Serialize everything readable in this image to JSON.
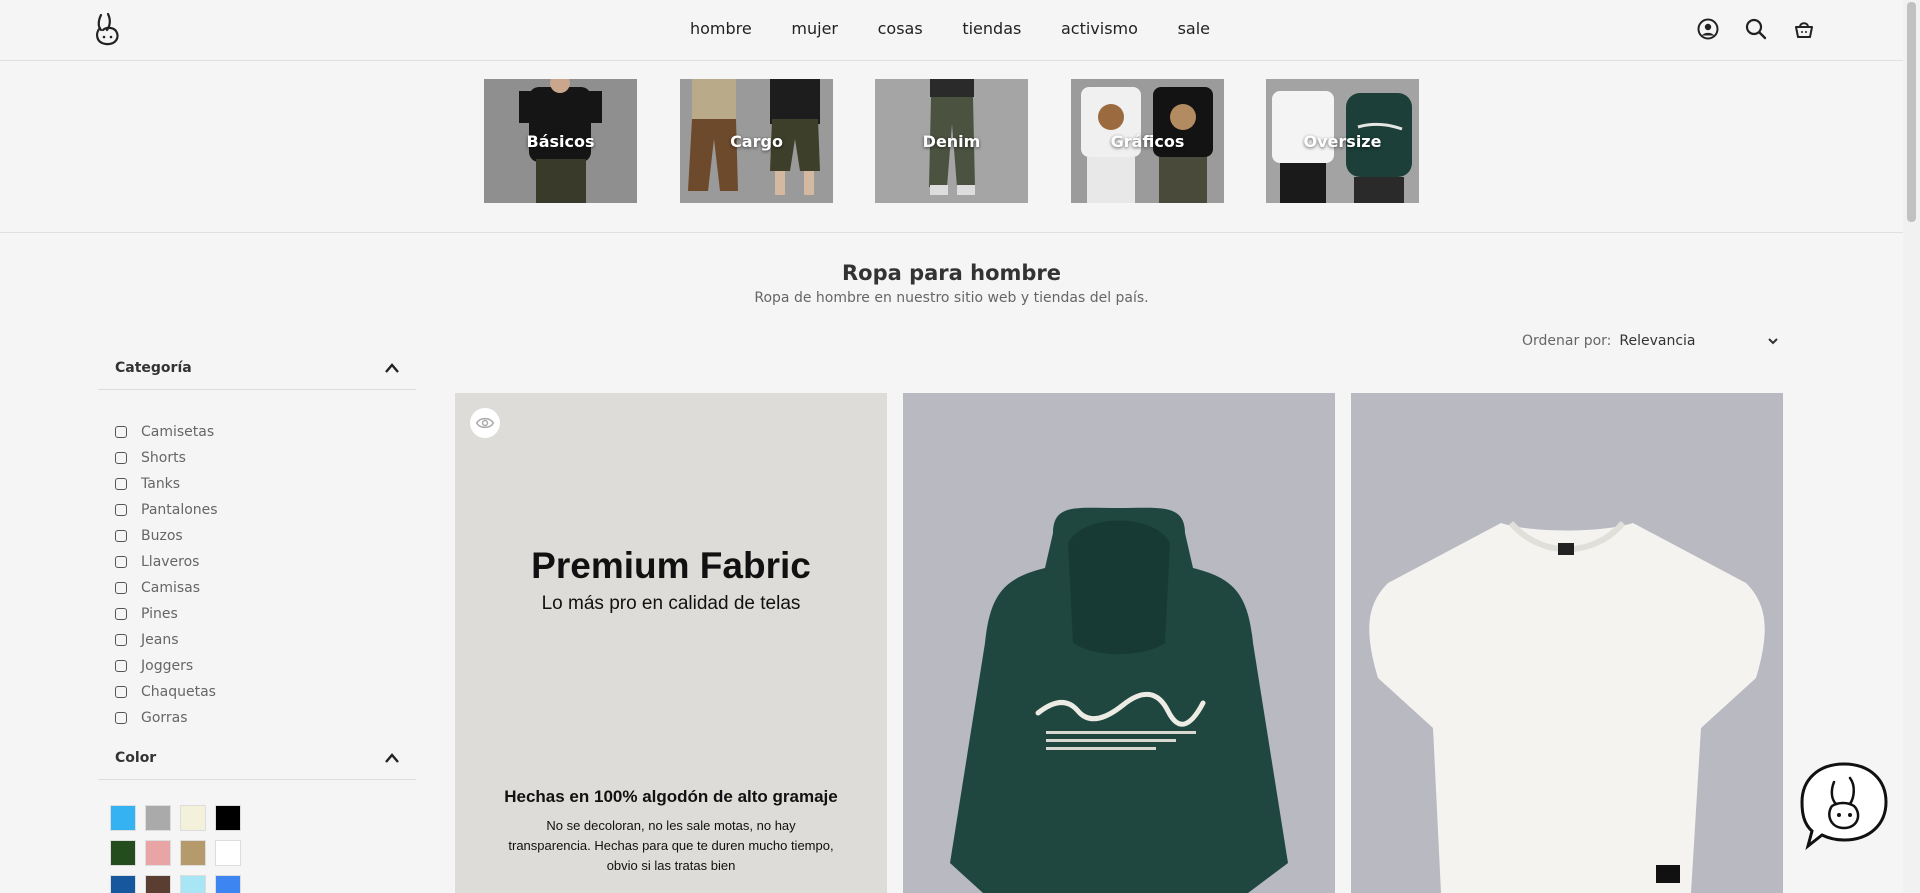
{
  "nav": {
    "items": [
      "hombre",
      "mujer",
      "cosas",
      "tiendas",
      "activismo"
    ],
    "sale": "sale"
  },
  "categories": [
    "Básicos",
    "Cargo",
    "Denim",
    "Gráficos",
    "Oversize"
  ],
  "page": {
    "title": "Ropa para hombre",
    "subtitle": "Ropa de hombre en nuestro sitio web y tiendas del país."
  },
  "sort": {
    "label": "Ordenar por:",
    "value": "Relevancia"
  },
  "filters": {
    "category": {
      "title": "Categoría",
      "items": [
        "Camisetas",
        "Shorts",
        "Tanks",
        "Pantalones",
        "Buzos",
        "Llaveros",
        "Camisas",
        "Pines",
        "Jeans",
        "Joggers",
        "Chaquetas",
        "Gorras"
      ]
    },
    "color": {
      "title": "Color",
      "swatches": [
        "#35b2f2",
        "#aaaaaa",
        "#f3f1d9",
        "#000000",
        "#234d1d",
        "#e9a4a6",
        "#b59a6b",
        "#ffffff",
        "#16579e",
        "#5a3e32",
        "#a9e6f5",
        "#3d86f2"
      ]
    }
  },
  "promo": {
    "title": "Premium Fabric",
    "subtitle": "Lo más pro en calidad de telas",
    "heading": "Hechas en 100% algodón de alto gramaje",
    "body": "No se decoloran, no les sale motas, no hay transparencia. Hechas para que te duren mucho tiempo, obvio si las tratas bien"
  }
}
